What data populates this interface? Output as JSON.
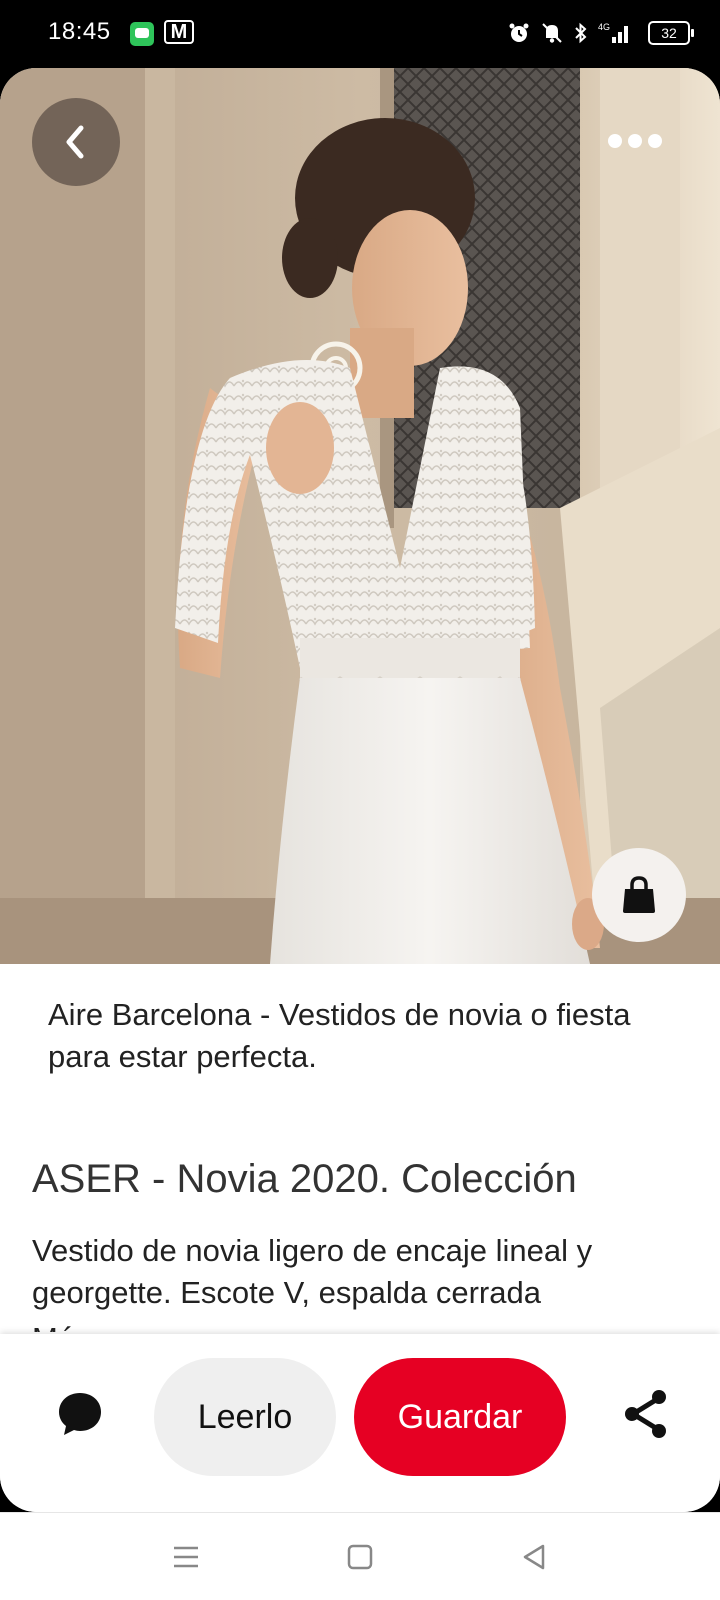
{
  "status_bar": {
    "time": "18:45",
    "battery": "32",
    "network": "4G"
  },
  "top_actions": {
    "back_icon": "chevron-left-icon",
    "more_icon": "ellipsis-icon"
  },
  "photo": {
    "subject": "bridal-dress-photo"
  },
  "shop_icon": "shopping-bag-icon",
  "pin": {
    "source_title": "Aire Barcelona - Vestidos de novia o fiesta para estar perfecta.",
    "title": "ASER - Novia 2020. Colección",
    "description": "Vestido de novia ligero de encaje lineal y georgette. Escote V, espalda cerrada",
    "more_label": "Más"
  },
  "actions": {
    "comment_icon": "speech-bubble-icon",
    "read_label": "Leerlo",
    "save_label": "Guardar",
    "share_icon": "share-icon",
    "accent_color": "#e60023"
  },
  "nav": {
    "menu_icon": "menu-icon",
    "home_icon": "square-home-icon",
    "back_icon": "triangle-back-icon"
  }
}
